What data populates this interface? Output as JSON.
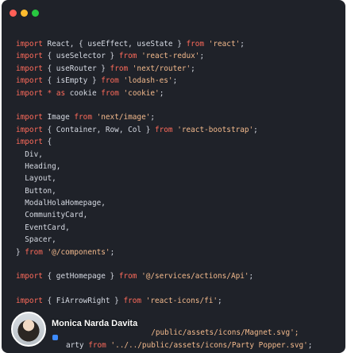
{
  "window": {
    "controls": [
      {
        "name": "close",
        "color": "#ff5f57"
      },
      {
        "name": "minimize",
        "color": "#febc2e"
      },
      {
        "name": "maximize",
        "color": "#28c840"
      }
    ]
  },
  "colors": {
    "background": "#1f2229",
    "keyword": "#ff6b5b",
    "string": "#f2b98c",
    "text": "#d6dae3"
  },
  "code_lines": [
    [
      {
        "t": "kw",
        "v": "import"
      },
      {
        "t": "plain",
        "v": " React, { useEffect, useState } "
      },
      {
        "t": "kw",
        "v": "from"
      },
      {
        "t": "plain",
        "v": " "
      },
      {
        "t": "str",
        "v": "'react'"
      },
      {
        "t": "plain",
        "v": ";"
      }
    ],
    [
      {
        "t": "kw",
        "v": "import"
      },
      {
        "t": "plain",
        "v": " { useSelector } "
      },
      {
        "t": "kw",
        "v": "from"
      },
      {
        "t": "plain",
        "v": " "
      },
      {
        "t": "str",
        "v": "'react-redux'"
      },
      {
        "t": "plain",
        "v": ";"
      }
    ],
    [
      {
        "t": "kw",
        "v": "import"
      },
      {
        "t": "plain",
        "v": " { useRouter } "
      },
      {
        "t": "kw",
        "v": "from"
      },
      {
        "t": "plain",
        "v": " "
      },
      {
        "t": "str",
        "v": "'next/router'"
      },
      {
        "t": "plain",
        "v": ";"
      }
    ],
    [
      {
        "t": "kw",
        "v": "import"
      },
      {
        "t": "plain",
        "v": " { isEmpty } "
      },
      {
        "t": "kw",
        "v": "from"
      },
      {
        "t": "plain",
        "v": " "
      },
      {
        "t": "str",
        "v": "'lodash-es'"
      },
      {
        "t": "plain",
        "v": ";"
      }
    ],
    [
      {
        "t": "kw",
        "v": "import"
      },
      {
        "t": "plain",
        "v": " "
      },
      {
        "t": "kw",
        "v": "*"
      },
      {
        "t": "plain",
        "v": " "
      },
      {
        "t": "kw",
        "v": "as"
      },
      {
        "t": "plain",
        "v": " cookie "
      },
      {
        "t": "kw",
        "v": "from"
      },
      {
        "t": "plain",
        "v": " "
      },
      {
        "t": "str",
        "v": "'cookie'"
      },
      {
        "t": "plain",
        "v": ";"
      }
    ],
    [],
    [
      {
        "t": "kw",
        "v": "import"
      },
      {
        "t": "plain",
        "v": " Image "
      },
      {
        "t": "kw",
        "v": "from"
      },
      {
        "t": "plain",
        "v": " "
      },
      {
        "t": "str",
        "v": "'next/image'"
      },
      {
        "t": "plain",
        "v": ";"
      }
    ],
    [
      {
        "t": "kw",
        "v": "import"
      },
      {
        "t": "plain",
        "v": " { Container, Row, Col } "
      },
      {
        "t": "kw",
        "v": "from"
      },
      {
        "t": "plain",
        "v": " "
      },
      {
        "t": "str",
        "v": "'react-bootstrap'"
      },
      {
        "t": "plain",
        "v": ";"
      }
    ],
    [
      {
        "t": "kw",
        "v": "import"
      },
      {
        "t": "plain",
        "v": " {"
      }
    ],
    [
      {
        "t": "plain",
        "v": "  Div,"
      }
    ],
    [
      {
        "t": "plain",
        "v": "  Heading,"
      }
    ],
    [
      {
        "t": "plain",
        "v": "  Layout,"
      }
    ],
    [
      {
        "t": "plain",
        "v": "  Button,"
      }
    ],
    [
      {
        "t": "plain",
        "v": "  ModalHolaHomepage,"
      }
    ],
    [
      {
        "t": "plain",
        "v": "  CommunityCard,"
      }
    ],
    [
      {
        "t": "plain",
        "v": "  EventCard,"
      }
    ],
    [
      {
        "t": "plain",
        "v": "  Spacer,"
      }
    ],
    [
      {
        "t": "plain",
        "v": "} "
      },
      {
        "t": "kw",
        "v": "from"
      },
      {
        "t": "plain",
        "v": " "
      },
      {
        "t": "str",
        "v": "'@/components'"
      },
      {
        "t": "plain",
        "v": ";"
      }
    ],
    [],
    [
      {
        "t": "kw",
        "v": "import"
      },
      {
        "t": "plain",
        "v": " { getHomepage } "
      },
      {
        "t": "kw",
        "v": "from"
      },
      {
        "t": "plain",
        "v": " "
      },
      {
        "t": "str",
        "v": "'@/services/actions/Api'"
      },
      {
        "t": "plain",
        "v": ";"
      }
    ],
    [],
    [
      {
        "t": "kw",
        "v": "import"
      },
      {
        "t": "plain",
        "v": " { FiArrowRight } "
      },
      {
        "t": "kw",
        "v": "from"
      },
      {
        "t": "plain",
        "v": " "
      },
      {
        "t": "str",
        "v": "'react-icons/fi'"
      },
      {
        "t": "plain",
        "v": ";"
      }
    ]
  ],
  "footer": {
    "author_name": "Monica Narda Davita",
    "line1_text": "/public/assets/icons/Magnet.svg';",
    "line2_prefix": "arty ",
    "line2_from": "from",
    "line2_string": "'../../public/assets/icons/Party Popper.svg'",
    "line2_suffix": ";"
  }
}
